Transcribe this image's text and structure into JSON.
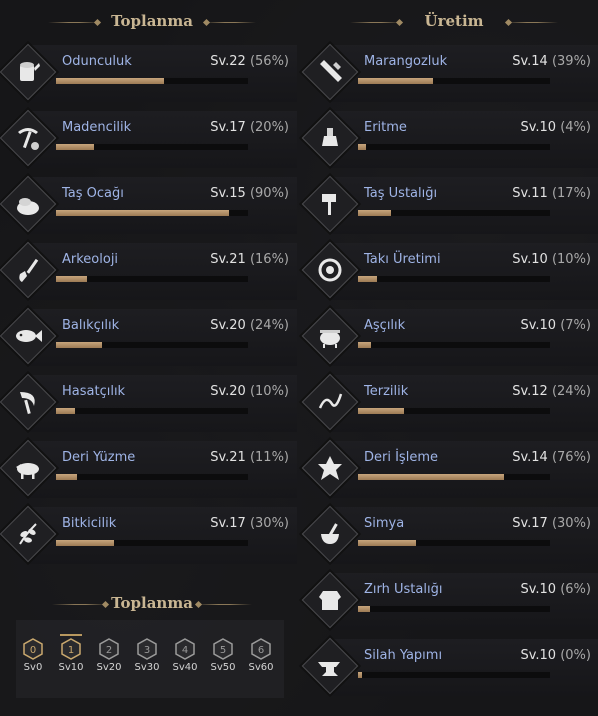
{
  "gathering": {
    "title": "Toplanma",
    "skills": [
      {
        "name": "Odunculuk",
        "level": "Sv.22",
        "percent": "(56%)",
        "progress": 56,
        "icon": "log-icon"
      },
      {
        "name": "Madencilik",
        "level": "Sv.17",
        "percent": "(20%)",
        "progress": 20,
        "icon": "pickaxe-icon"
      },
      {
        "name": "Taş Ocağı",
        "level": "Sv.15",
        "percent": "(90%)",
        "progress": 90,
        "icon": "stone-icon"
      },
      {
        "name": "Arkeoloji",
        "level": "Sv.21",
        "percent": "(16%)",
        "progress": 16,
        "icon": "shovel-icon"
      },
      {
        "name": "Balıkçılık",
        "level": "Sv.20",
        "percent": "(24%)",
        "progress": 24,
        "icon": "fish-icon"
      },
      {
        "name": "Hasatçılık",
        "level": "Sv.20",
        "percent": "(10%)",
        "progress": 10,
        "icon": "sickle-icon"
      },
      {
        "name": "Deri Yüzme",
        "level": "Sv.21",
        "percent": "(11%)",
        "progress": 11,
        "icon": "boar-icon"
      },
      {
        "name": "Bitkicilik",
        "level": "Sv.17",
        "percent": "(30%)",
        "progress": 30,
        "icon": "herb-icon"
      }
    ]
  },
  "crafting": {
    "title": "Üretim",
    "skills": [
      {
        "name": "Marangozluk",
        "level": "Sv.14",
        "percent": "(39%)",
        "progress": 39,
        "icon": "saw-icon"
      },
      {
        "name": "Eritme",
        "level": "Sv.10",
        "percent": "(4%)",
        "progress": 4,
        "icon": "furnace-icon"
      },
      {
        "name": "Taş Ustalığı",
        "level": "Sv.11",
        "percent": "(17%)",
        "progress": 17,
        "icon": "hammer-icon"
      },
      {
        "name": "Takı Üretimi",
        "level": "Sv.10",
        "percent": "(10%)",
        "progress": 10,
        "icon": "gem-icon"
      },
      {
        "name": "Aşçılık",
        "level": "Sv.10",
        "percent": "(7%)",
        "progress": 7,
        "icon": "cauldron-icon"
      },
      {
        "name": "Terzilik",
        "level": "Sv.12",
        "percent": "(24%)",
        "progress": 24,
        "icon": "needle-icon"
      },
      {
        "name": "Deri İşleme",
        "level": "Sv.14",
        "percent": "(76%)",
        "progress": 76,
        "icon": "hide-icon"
      },
      {
        "name": "Simya",
        "level": "Sv.17",
        "percent": "(30%)",
        "progress": 30,
        "icon": "mortar-icon"
      },
      {
        "name": "Zırh Ustalığı",
        "level": "Sv.10",
        "percent": "(6%)",
        "progress": 6,
        "icon": "armor-icon"
      },
      {
        "name": "Silah Yapımı",
        "level": "Sv.10",
        "percent": "(0%)",
        "progress": 0,
        "icon": "anvil-icon"
      }
    ]
  },
  "tiers_section": {
    "title": "Toplanma",
    "tiers": [
      {
        "num": "0",
        "label": "Sv0",
        "active": true
      },
      {
        "num": "1",
        "label": "Sv10",
        "active": true
      },
      {
        "num": "2",
        "label": "Sv20",
        "active": false
      },
      {
        "num": "3",
        "label": "Sv30",
        "active": false
      },
      {
        "num": "4",
        "label": "Sv40",
        "active": false
      },
      {
        "num": "5",
        "label": "Sv50",
        "active": false
      },
      {
        "num": "6",
        "label": "Sv60",
        "active": false
      }
    ]
  },
  "colors": {
    "accent_gold": "#c9b693",
    "skill_name": "#9fb4e6",
    "bar_fill": "#b8956a"
  }
}
